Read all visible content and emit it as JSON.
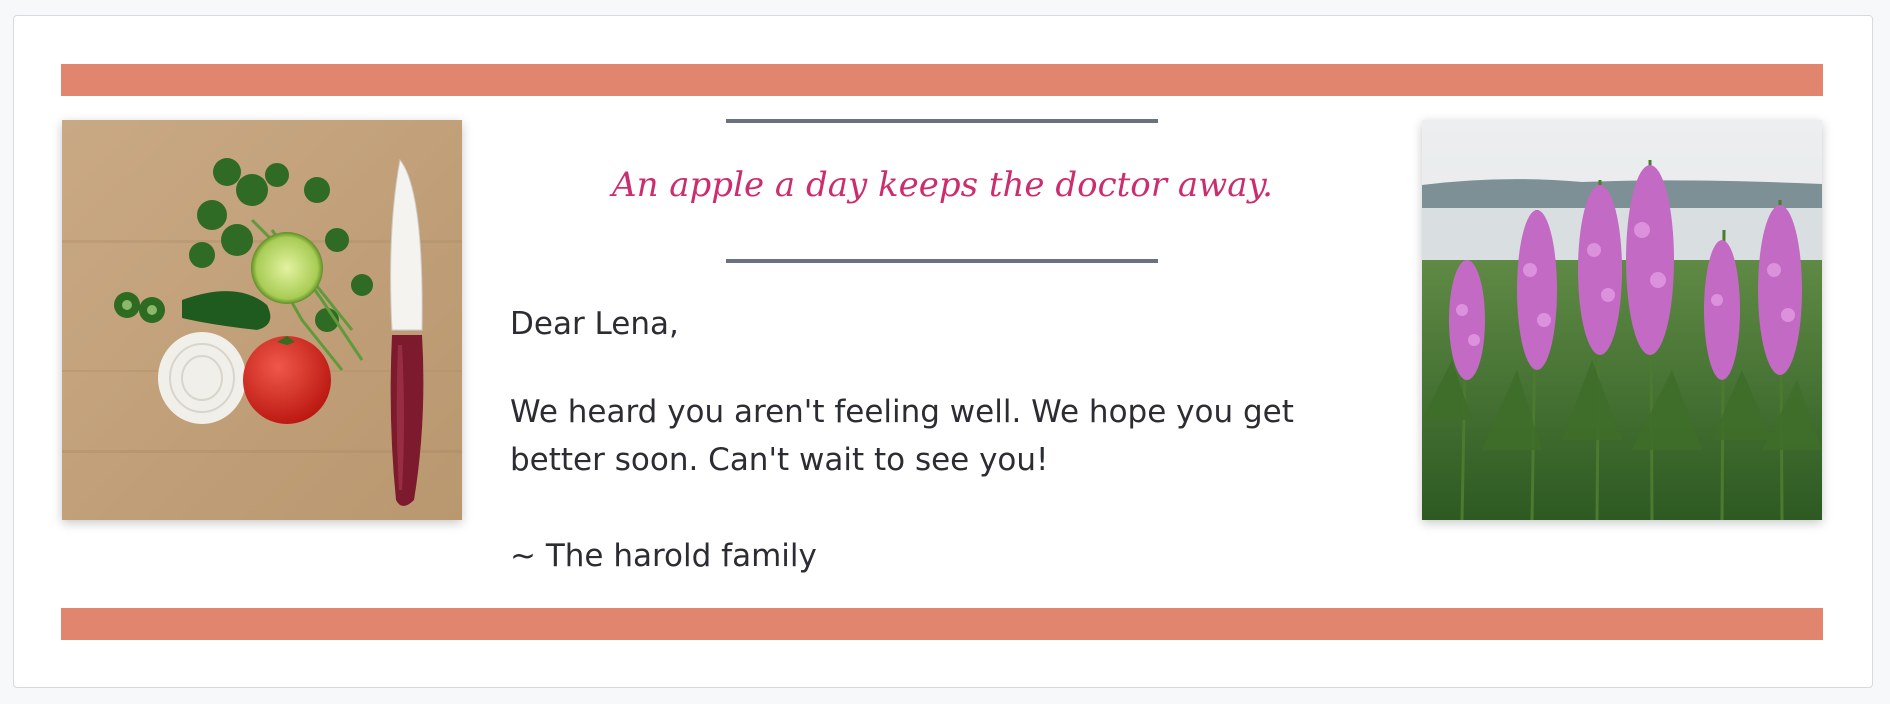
{
  "card": {
    "quote": "An apple a day keeps the doctor away.",
    "greeting": "Dear Lena,",
    "message": "We heard you aren't feeling well. We hope you get better soon. Can't wait to see you!",
    "signature": "~ The harold family"
  },
  "images": {
    "left": "vegetables-and-knife-photo",
    "right": "pink-fireweed-flowers-photo"
  },
  "colors": {
    "stripe": "#e2856e",
    "quote": "#cc2d6f",
    "rule": "#6b7180",
    "text": "#2b2d33"
  }
}
